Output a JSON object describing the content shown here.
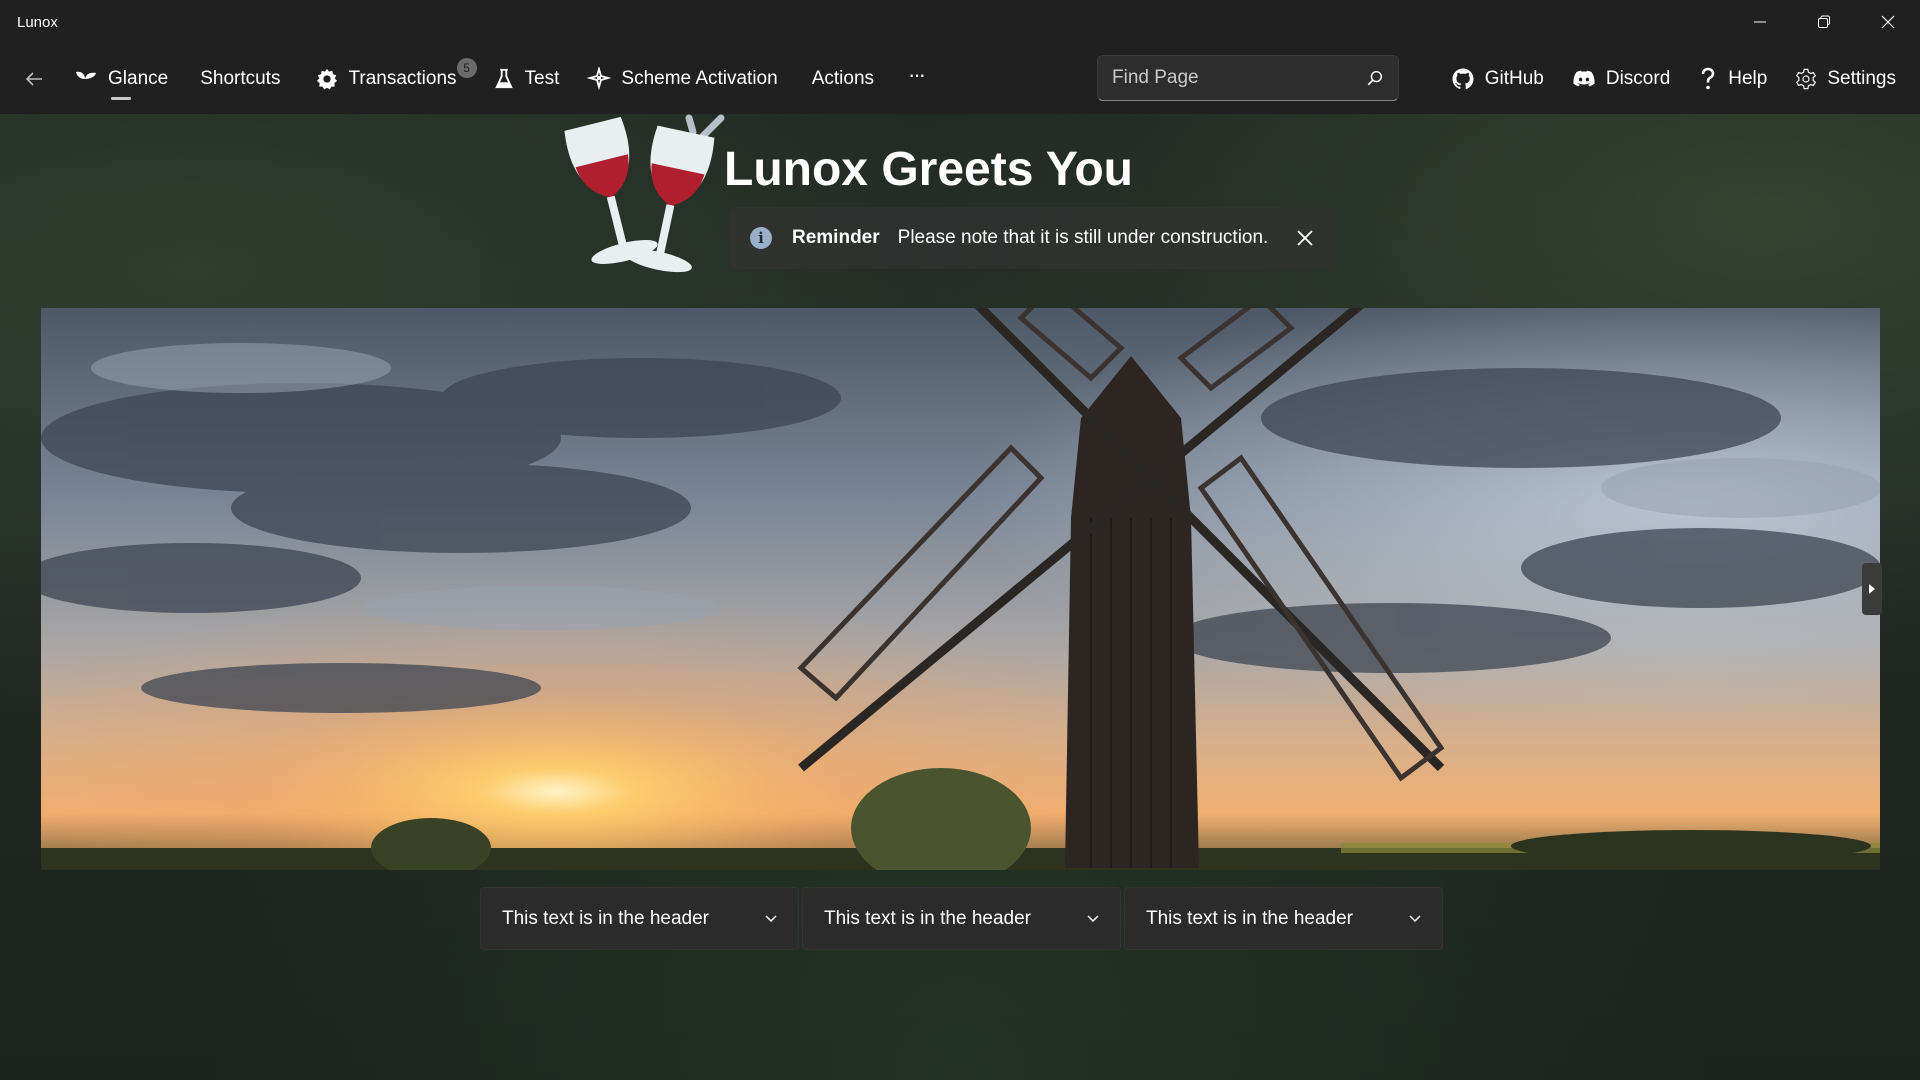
{
  "window": {
    "title": "Lunox"
  },
  "nav": {
    "items": [
      {
        "label": "Glance",
        "icon": "plant-icon",
        "selected": true
      },
      {
        "label": "Shortcuts"
      },
      {
        "label": "Transactions",
        "icon": "gear-icon",
        "badge": "5"
      },
      {
        "label": "Test",
        "icon": "flask-icon"
      },
      {
        "label": "Scheme Activation",
        "icon": "sparkle-icon"
      },
      {
        "label": "Actions"
      },
      {
        "label": "···",
        "icon": "more-icon"
      }
    ],
    "search": {
      "placeholder": "Find Page"
    },
    "links": [
      {
        "label": "GitHub",
        "icon": "github-icon"
      },
      {
        "label": "Discord",
        "icon": "discord-icon"
      },
      {
        "label": "Help",
        "icon": "question-icon"
      },
      {
        "label": "Settings",
        "icon": "gear-icon"
      }
    ]
  },
  "hero": {
    "title": "Lunox Greets You",
    "infobar": {
      "title": "Reminder",
      "message": "Please note that it is still under construction."
    }
  },
  "expanders": [
    {
      "header": "This text is in the header"
    },
    {
      "header": "This text is in the header"
    },
    {
      "header": "This text is in the header"
    }
  ],
  "colors": {
    "chrome": "#202020",
    "wine": "#b01f2e",
    "info_icon": "#9ab0c8"
  }
}
